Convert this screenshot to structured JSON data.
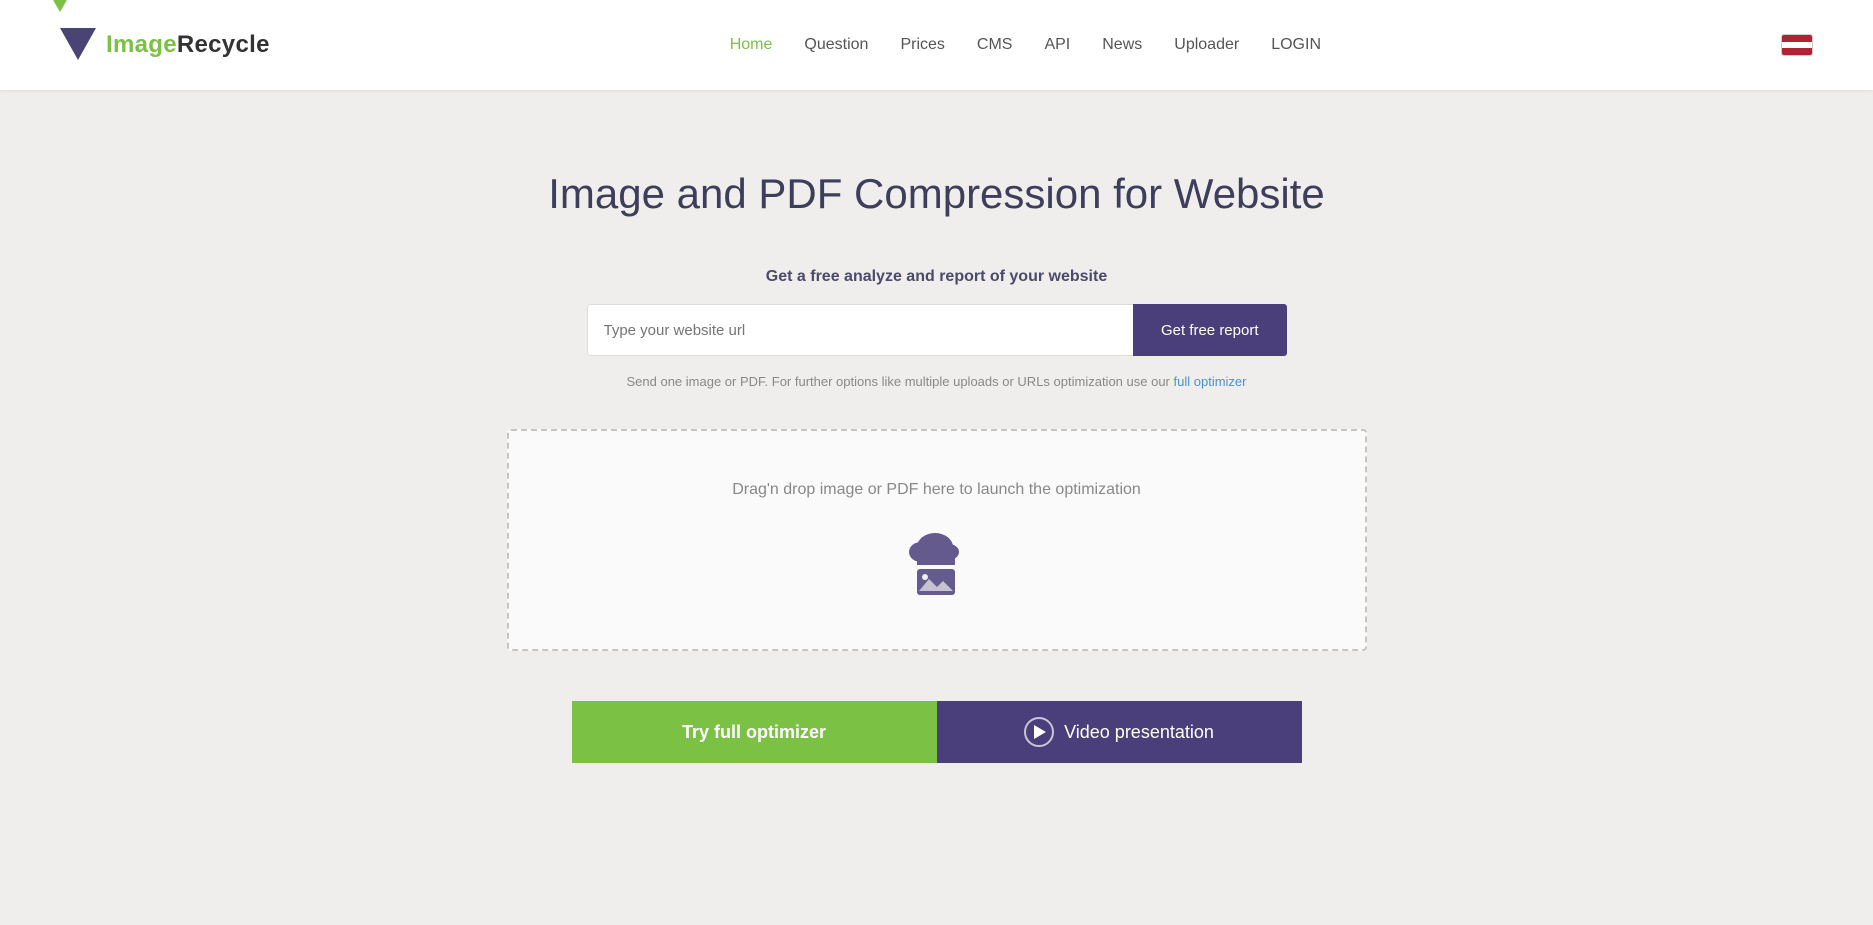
{
  "header": {
    "logo_image": "Image",
    "logo_bold": "Recycle",
    "nav": {
      "home": "Home",
      "question": "Question",
      "prices": "Prices",
      "cms": "CMS",
      "api": "API",
      "news": "News",
      "uploader": "Uploader",
      "login": "LOGIN"
    }
  },
  "main": {
    "title": "Image and PDF Compression for Website",
    "subtitle": "Get a free analyze and report of your website",
    "url_input_placeholder": "Type your website url",
    "get_report_button": "Get free report",
    "hint": "Send one image or PDF. For further options like multiple uploads or URLs optimization use our",
    "hint_link": "full optimizer",
    "drop_zone_text": "Drag'n drop image or PDF here to launch the optimization",
    "try_optimizer_button": "Try full optimizer",
    "video_button": "Video presentation"
  }
}
